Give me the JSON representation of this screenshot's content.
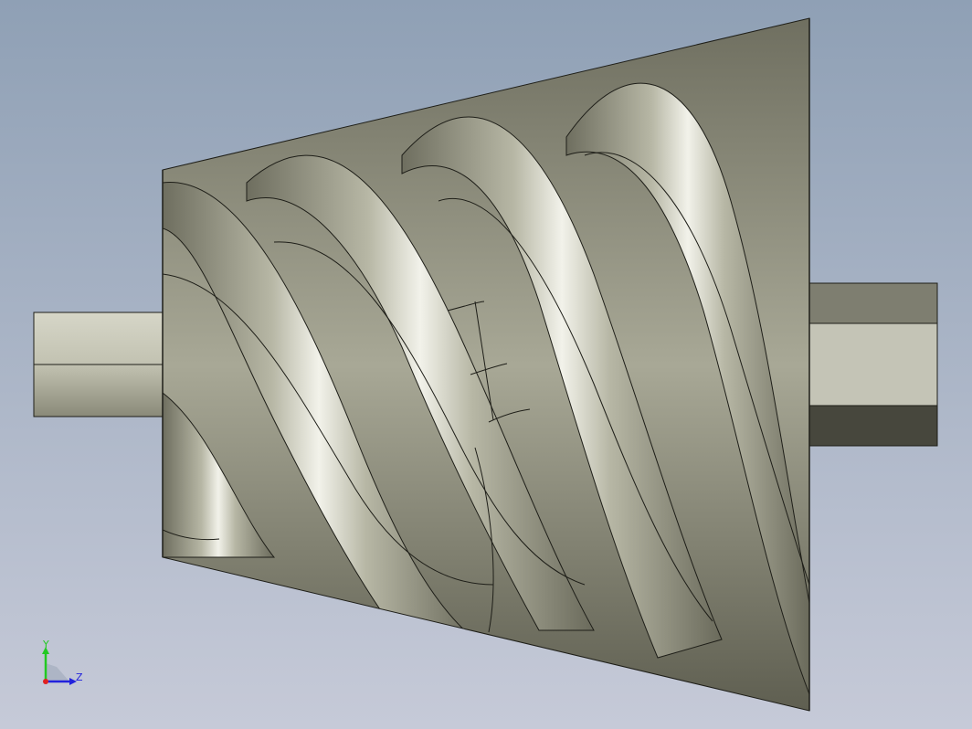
{
  "viewport": {
    "background_top": "#8fa0b5",
    "background_bottom": "#c4c8d6"
  },
  "model": {
    "body_color": "#a9a995",
    "edge_color": "#1e1e18"
  },
  "triad": {
    "y_label": "Y",
    "z_label": "Z",
    "y_color": "#22c922",
    "z_color": "#2222dd",
    "x_color": "#e02020"
  }
}
